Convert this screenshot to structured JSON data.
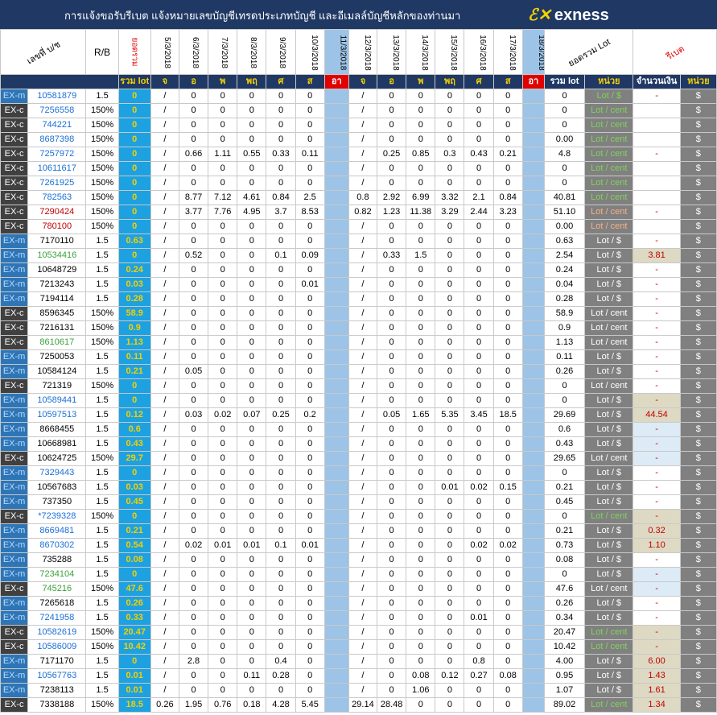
{
  "title": "การแจ้งขอรับรีเบต  แจ้งหมายเลขบัญชีเทรดประเภทบัญชี และอีเมลล์บัญชีหลักของท่านมา",
  "brand": "exness",
  "headers": {
    "account": "เลขที่ บ/ช",
    "rb": "R/B",
    "total_top": "ยอดรวม",
    "dates": [
      "5/3/2018",
      "6/3/2018",
      "7/3/2018",
      "8/3/2018",
      "9/3/2018",
      "10/3/2018",
      "11/3/2018",
      "12/3/2018",
      "13/3/2018",
      "14/3/2018",
      "15/3/2018",
      "16/3/2018",
      "17/3/2018",
      "18/3/2018"
    ],
    "sum_lot": "ยอดรวม Lot",
    "rebate": "รีเบต"
  },
  "subheaders": {
    "total_lot": "รวม lot",
    "days": [
      "จ",
      "อ",
      "พ",
      "พฤ",
      "ศ",
      "ส",
      "อา",
      "จ",
      "อ",
      "พ",
      "พฤ",
      "ศ",
      "ส",
      "อา"
    ],
    "sum": "รวม lot",
    "unit": "หน่วย",
    "amount": "จำนวนเงิน",
    "unit2": "หน่วย"
  },
  "rows": [
    {
      "type": "EX-m",
      "acc": "10581879",
      "rb": "1.5",
      "tot": "0",
      "w1": [
        "/",
        "0",
        "0",
        "0",
        "0",
        "0"
      ],
      "w2": [
        "/",
        "0",
        "0",
        "0",
        "0",
        "0"
      ],
      "sum": "0",
      "unit": "Lot / $",
      "amt": "-",
      "cur": "$"
    },
    {
      "type": "EX-c",
      "acc": "7256558",
      "rb": "150%",
      "tot": "0",
      "w1": [
        "/",
        "0",
        "0",
        "0",
        "0",
        "0"
      ],
      "w2": [
        "/",
        "0",
        "0",
        "0",
        "0",
        "0"
      ],
      "sum": "0",
      "unit": "Lot / cent",
      "amt": "",
      "cur": "$"
    },
    {
      "type": "EX-c",
      "acc": "744221",
      "rb": "150%",
      "tot": "0",
      "w1": [
        "/",
        "0",
        "0",
        "0",
        "0",
        "0"
      ],
      "w2": [
        "/",
        "0",
        "0",
        "0",
        "0",
        "0"
      ],
      "sum": "0",
      "unit": "Lot / cent",
      "amt": "",
      "cur": "$"
    },
    {
      "type": "EX-c",
      "acc": "8687398",
      "rb": "150%",
      "tot": "0",
      "w1": [
        "/",
        "0",
        "0",
        "0",
        "0",
        "0"
      ],
      "w2": [
        "/",
        "0",
        "0",
        "0",
        "0",
        "0"
      ],
      "sum": "0.00",
      "unit": "Lot / cent",
      "amt": "",
      "cur": "$"
    },
    {
      "type": "EX-c",
      "acc": "7257972",
      "rb": "150%",
      "tot": "0",
      "w1": [
        "/",
        "0.66",
        "1.11",
        "0.55",
        "0.33",
        "0.11"
      ],
      "w2": [
        "/",
        "0.25",
        "0.85",
        "0.3",
        "0.43",
        "0.21"
      ],
      "sum": "4.8",
      "unit": "Lot / cent",
      "amt": "-",
      "cur": "$"
    },
    {
      "type": "EX-c",
      "acc": "10611617",
      "rb": "150%",
      "tot": "0",
      "w1": [
        "/",
        "0",
        "0",
        "0",
        "0",
        "0"
      ],
      "w2": [
        "/",
        "0",
        "0",
        "0",
        "0",
        "0"
      ],
      "sum": "0",
      "unit": "Lot / cent",
      "amt": "",
      "cur": "$"
    },
    {
      "type": "EX-c",
      "acc": "7261925",
      "rb": "150%",
      "tot": "0",
      "w1": [
        "/",
        "0",
        "0",
        "0",
        "0",
        "0"
      ],
      "w2": [
        "/",
        "0",
        "0",
        "0",
        "0",
        "0"
      ],
      "sum": "0",
      "unit": "Lot / cent",
      "amt": "",
      "cur": "$"
    },
    {
      "type": "EX-c",
      "acc": "782563",
      "rb": "150%",
      "tot": "0",
      "w1": [
        "/",
        "8.77",
        "7.12",
        "4.61",
        "0.84",
        "2.5"
      ],
      "w2": [
        "0.8",
        "2.92",
        "6.99",
        "3.32",
        "2.1",
        "0.84"
      ],
      "sum": "40.81",
      "unit": "Lot / cent",
      "amt": "",
      "cur": "$"
    },
    {
      "type": "EX-c",
      "acc": "7290424",
      "rb": "150%",
      "tot": "0",
      "w1": [
        "/",
        "3.77",
        "7.76",
        "4.95",
        "3.7",
        "8.53"
      ],
      "w2": [
        "0.82",
        "1.23",
        "11.38",
        "3.29",
        "2.44",
        "3.23"
      ],
      "sum": "51.10",
      "unit": "Lot / cent",
      "amt": "-",
      "cur": "$"
    },
    {
      "type": "EX-c",
      "acc": "780100",
      "rb": "150%",
      "tot": "0",
      "w1": [
        "/",
        "0",
        "0",
        "0",
        "0",
        "0"
      ],
      "w2": [
        "/",
        "0",
        "0",
        "0",
        "0",
        "0"
      ],
      "sum": "0.00",
      "unit": "Lot / cent",
      "amt": "",
      "cur": "$"
    },
    {
      "type": "EX-m",
      "acc": "7170110",
      "rb": "1.5",
      "tot": "0.63",
      "w1": [
        "/",
        "0",
        "0",
        "0",
        "0",
        "0"
      ],
      "w2": [
        "/",
        "0",
        "0",
        "0",
        "0",
        "0"
      ],
      "sum": "0.63",
      "unit": "Lot / $",
      "amt": "-",
      "cur": "$"
    },
    {
      "type": "EX-m",
      "acc": "10534416",
      "rb": "1.5",
      "tot": "0",
      "w1": [
        "/",
        "0.52",
        "0",
        "0",
        "0.1",
        "0.09"
      ],
      "w2": [
        "/",
        "0.33",
        "1.5",
        "0",
        "0",
        "0"
      ],
      "sum": "2.54",
      "unit": "Lot / $",
      "amt": "3.81",
      "cur": "$"
    },
    {
      "type": "EX-m",
      "acc": "10648729",
      "rb": "1.5",
      "tot": "0.24",
      "w1": [
        "/",
        "0",
        "0",
        "0",
        "0",
        "0"
      ],
      "w2": [
        "/",
        "0",
        "0",
        "0",
        "0",
        "0"
      ],
      "sum": "0.24",
      "unit": "Lot / $",
      "amt": "-",
      "cur": "$"
    },
    {
      "type": "EX-m",
      "acc": "7213243",
      "rb": "1.5",
      "tot": "0.03",
      "w1": [
        "/",
        "0",
        "0",
        "0",
        "0",
        "0.01"
      ],
      "w2": [
        "/",
        "0",
        "0",
        "0",
        "0",
        "0"
      ],
      "sum": "0.04",
      "unit": "Lot / $",
      "amt": "-",
      "cur": "$"
    },
    {
      "type": "EX-m",
      "acc": "7194114",
      "rb": "1.5",
      "tot": "0.28",
      "w1": [
        "/",
        "0",
        "0",
        "0",
        "0",
        "0"
      ],
      "w2": [
        "/",
        "0",
        "0",
        "0",
        "0",
        "0"
      ],
      "sum": "0.28",
      "unit": "Lot / $",
      "amt": "-",
      "cur": "$"
    },
    {
      "type": "EX-c",
      "acc": "8596345",
      "rb": "150%",
      "tot": "58.9",
      "w1": [
        "/",
        "0",
        "0",
        "0",
        "0",
        "0"
      ],
      "w2": [
        "/",
        "0",
        "0",
        "0",
        "0",
        "0"
      ],
      "sum": "58.9",
      "unit": "Lot / cent",
      "amt": "-",
      "cur": "$"
    },
    {
      "type": "EX-c",
      "acc": "7216131",
      "rb": "150%",
      "tot": "0.9",
      "w1": [
        "/",
        "0",
        "0",
        "0",
        "0",
        "0"
      ],
      "w2": [
        "/",
        "0",
        "0",
        "0",
        "0",
        "0"
      ],
      "sum": "0.9",
      "unit": "Lot / cent",
      "amt": "-",
      "cur": "$"
    },
    {
      "type": "EX-c",
      "acc": "8610617",
      "rb": "150%",
      "tot": "1.13",
      "w1": [
        "/",
        "0",
        "0",
        "0",
        "0",
        "0"
      ],
      "w2": [
        "/",
        "0",
        "0",
        "0",
        "0",
        "0"
      ],
      "sum": "1.13",
      "unit": "Lot / cent",
      "amt": "-",
      "cur": "$"
    },
    {
      "type": "EX-m",
      "acc": "7250053",
      "rb": "1.5",
      "tot": "0.11",
      "w1": [
        "/",
        "0",
        "0",
        "0",
        "0",
        "0"
      ],
      "w2": [
        "/",
        "0",
        "0",
        "0",
        "0",
        "0"
      ],
      "sum": "0.11",
      "unit": "Lot / $",
      "amt": "-",
      "cur": "$"
    },
    {
      "type": "EX-m",
      "acc": "10584124",
      "rb": "1.5",
      "tot": "0.21",
      "w1": [
        "/",
        "0.05",
        "0",
        "0",
        "0",
        "0"
      ],
      "w2": [
        "/",
        "0",
        "0",
        "0",
        "0",
        "0"
      ],
      "sum": "0.26",
      "unit": "Lot / $",
      "amt": "-",
      "cur": "$"
    },
    {
      "type": "EX-c",
      "acc": "721319",
      "rb": "150%",
      "tot": "0",
      "w1": [
        "/",
        "0",
        "0",
        "0",
        "0",
        "0"
      ],
      "w2": [
        "/",
        "0",
        "0",
        "0",
        "0",
        "0"
      ],
      "sum": "0",
      "unit": "Lot / cent",
      "amt": "-",
      "cur": "$"
    },
    {
      "type": "EX-m",
      "acc": "10589441",
      "rb": "1.5",
      "tot": "0",
      "w1": [
        "/",
        "0",
        "0",
        "0",
        "0",
        "0"
      ],
      "w2": [
        "/",
        "0",
        "0",
        "0",
        "0",
        "0"
      ],
      "sum": "0",
      "unit": "Lot / $",
      "amt": "-",
      "cur": "$"
    },
    {
      "type": "EX-m",
      "acc": "10597513",
      "rb": "1.5",
      "tot": "0.12",
      "w1": [
        "/",
        "0.03",
        "0.02",
        "0.07",
        "0.25",
        "0.2"
      ],
      "w2": [
        "/",
        "0.05",
        "1.65",
        "5.35",
        "3.45",
        "18.5"
      ],
      "sum": "29.69",
      "unit": "Lot / $",
      "amt": "44.54",
      "cur": "$"
    },
    {
      "type": "EX-m",
      "acc": "8668455",
      "rb": "1.5",
      "tot": "0.6",
      "w1": [
        "/",
        "0",
        "0",
        "0",
        "0",
        "0"
      ],
      "w2": [
        "/",
        "0",
        "0",
        "0",
        "0",
        "0"
      ],
      "sum": "0.6",
      "unit": "Lot / $",
      "amt": "-",
      "cur": "$"
    },
    {
      "type": "EX-m",
      "acc": "10668981",
      "rb": "1.5",
      "tot": "0.43",
      "w1": [
        "/",
        "0",
        "0",
        "0",
        "0",
        "0"
      ],
      "w2": [
        "/",
        "0",
        "0",
        "0",
        "0",
        "0"
      ],
      "sum": "0.43",
      "unit": "Lot / $",
      "amt": "-",
      "cur": "$"
    },
    {
      "type": "EX-c",
      "acc": "10624725",
      "rb": "150%",
      "tot": "29.7",
      "w1": [
        "/",
        "0",
        "0",
        "0",
        "0",
        "0"
      ],
      "w2": [
        "/",
        "0",
        "0",
        "0",
        "0",
        "0"
      ],
      "sum": "29.65",
      "unit": "Lot / cent",
      "amt": "-",
      "cur": "$"
    },
    {
      "type": "EX-m",
      "acc": "7329443",
      "rb": "1.5",
      "tot": "0",
      "w1": [
        "/",
        "0",
        "0",
        "0",
        "0",
        "0"
      ],
      "w2": [
        "/",
        "0",
        "0",
        "0",
        "0",
        "0"
      ],
      "sum": "0",
      "unit": "Lot / $",
      "amt": "-",
      "cur": "$"
    },
    {
      "type": "EX-m",
      "acc": "10567683",
      "rb": "1.5",
      "tot": "0.03",
      "w1": [
        "/",
        "0",
        "0",
        "0",
        "0",
        "0"
      ],
      "w2": [
        "/",
        "0",
        "0",
        "0.01",
        "0.02",
        "0.15"
      ],
      "sum": "0.21",
      "unit": "Lot / $",
      "amt": "-",
      "cur": "$"
    },
    {
      "type": "EX-m",
      "acc": "737350",
      "rb": "1.5",
      "tot": "0.45",
      "w1": [
        "/",
        "0",
        "0",
        "0",
        "0",
        "0"
      ],
      "w2": [
        "/",
        "0",
        "0",
        "0",
        "0",
        "0"
      ],
      "sum": "0.45",
      "unit": "Lot / $",
      "amt": "-",
      "cur": "$"
    },
    {
      "type": "EX-c",
      "acc": "*7239328",
      "rb": "150%",
      "tot": "0",
      "w1": [
        "/",
        "0",
        "0",
        "0",
        "0",
        "0"
      ],
      "w2": [
        "/",
        "0",
        "0",
        "0",
        "0",
        "0"
      ],
      "sum": "0",
      "unit": "Lot / cent",
      "amt": "-",
      "cur": "$"
    },
    {
      "type": "EX-m",
      "acc": "8669481",
      "rb": "1.5",
      "tot": "0.21",
      "w1": [
        "/",
        "0",
        "0",
        "0",
        "0",
        "0"
      ],
      "w2": [
        "/",
        "0",
        "0",
        "0",
        "0",
        "0"
      ],
      "sum": "0.21",
      "unit": "Lot / $",
      "amt": "0.32",
      "cur": "$"
    },
    {
      "type": "EX-m",
      "acc": "8670302",
      "rb": "1.5",
      "tot": "0.54",
      "w1": [
        "/",
        "0.02",
        "0.01",
        "0.01",
        "0.1",
        "0.01"
      ],
      "w2": [
        "/",
        "0",
        "0",
        "0",
        "0.02",
        "0.02"
      ],
      "sum": "0.73",
      "unit": "Lot / $",
      "amt": "1.10",
      "cur": "$"
    },
    {
      "type": "EX-m",
      "acc": "735288",
      "rb": "1.5",
      "tot": "0.08",
      "w1": [
        "/",
        "0",
        "0",
        "0",
        "0",
        "0"
      ],
      "w2": [
        "/",
        "0",
        "0",
        "0",
        "0",
        "0"
      ],
      "sum": "0.08",
      "unit": "Lot / $",
      "amt": "-",
      "cur": "$"
    },
    {
      "type": "EX-m",
      "acc": "7234104",
      "rb": "1.5",
      "tot": "0",
      "w1": [
        "/",
        "0",
        "0",
        "0",
        "0",
        "0"
      ],
      "w2": [
        "/",
        "0",
        "0",
        "0",
        "0",
        "0"
      ],
      "sum": "0",
      "unit": "Lot / $",
      "amt": "-",
      "cur": "$"
    },
    {
      "type": "EX-c",
      "acc": "745216",
      "rb": "150%",
      "tot": "47.6",
      "w1": [
        "/",
        "0",
        "0",
        "0",
        "0",
        "0"
      ],
      "w2": [
        "/",
        "0",
        "0",
        "0",
        "0",
        "0"
      ],
      "sum": "47.6",
      "unit": "Lot / cent",
      "amt": "-",
      "cur": "$"
    },
    {
      "type": "EX-m",
      "acc": "7265618",
      "rb": "1.5",
      "tot": "0.26",
      "w1": [
        "/",
        "0",
        "0",
        "0",
        "0",
        "0"
      ],
      "w2": [
        "/",
        "0",
        "0",
        "0",
        "0",
        "0"
      ],
      "sum": "0.26",
      "unit": "Lot / $",
      "amt": "-",
      "cur": "$"
    },
    {
      "type": "EX-m",
      "acc": "7241958",
      "rb": "1.5",
      "tot": "0.33",
      "w1": [
        "/",
        "0",
        "0",
        "0",
        "0",
        "0"
      ],
      "w2": [
        "/",
        "0",
        "0",
        "0",
        "0.01",
        "0"
      ],
      "sum": "0.34",
      "unit": "Lot / $",
      "amt": "-",
      "cur": "$"
    },
    {
      "type": "EX-c",
      "acc": "10582619",
      "rb": "150%",
      "tot": "20.47",
      "w1": [
        "/",
        "0",
        "0",
        "0",
        "0",
        "0"
      ],
      "w2": [
        "/",
        "0",
        "0",
        "0",
        "0",
        "0"
      ],
      "sum": "20.47",
      "unit": "Lot / cent",
      "amt": "-",
      "cur": "$"
    },
    {
      "type": "EX-c",
      "acc": "10586009",
      "rb": "150%",
      "tot": "10.42",
      "w1": [
        "/",
        "0",
        "0",
        "0",
        "0",
        "0"
      ],
      "w2": [
        "/",
        "0",
        "0",
        "0",
        "0",
        "0"
      ],
      "sum": "10.42",
      "unit": "Lot / cent",
      "amt": "-",
      "cur": "$"
    },
    {
      "type": "EX-m",
      "acc": "7171170",
      "rb": "1.5",
      "tot": "0",
      "w1": [
        "/",
        "2.8",
        "0",
        "0",
        "0.4",
        "0"
      ],
      "w2": [
        "/",
        "0",
        "0",
        "0",
        "0.8",
        "0"
      ],
      "sum": "4.00",
      "unit": "Lot / $",
      "amt": "6.00",
      "cur": "$"
    },
    {
      "type": "EX-m",
      "acc": "10567763",
      "rb": "1.5",
      "tot": "0.01",
      "w1": [
        "/",
        "0",
        "0",
        "0.11",
        "0.28",
        "0"
      ],
      "w2": [
        "/",
        "0",
        "0.08",
        "0.12",
        "0.27",
        "0.08"
      ],
      "sum": "0.95",
      "unit": "Lot / $",
      "amt": "1.43",
      "cur": "$"
    },
    {
      "type": "EX-m",
      "acc": "7238113",
      "rb": "1.5",
      "tot": "0.01",
      "w1": [
        "/",
        "0",
        "0",
        "0",
        "0",
        "0"
      ],
      "w2": [
        "/",
        "0",
        "1.06",
        "0",
        "0",
        "0"
      ],
      "sum": "1.07",
      "unit": "Lot / $",
      "amt": "1.61",
      "cur": "$"
    },
    {
      "type": "EX-c",
      "acc": "7338188",
      "rb": "150%",
      "tot": "18.5",
      "w1": [
        "0.26",
        "1.95",
        "0.76",
        "0.18",
        "4.28",
        "5.45"
      ],
      "w2": [
        "29.14",
        "28.48",
        "0",
        "0",
        "0",
        "0"
      ],
      "sum": "89.02",
      "unit": "Lot / cent",
      "amt": "1.34",
      "cur": "$"
    }
  ]
}
